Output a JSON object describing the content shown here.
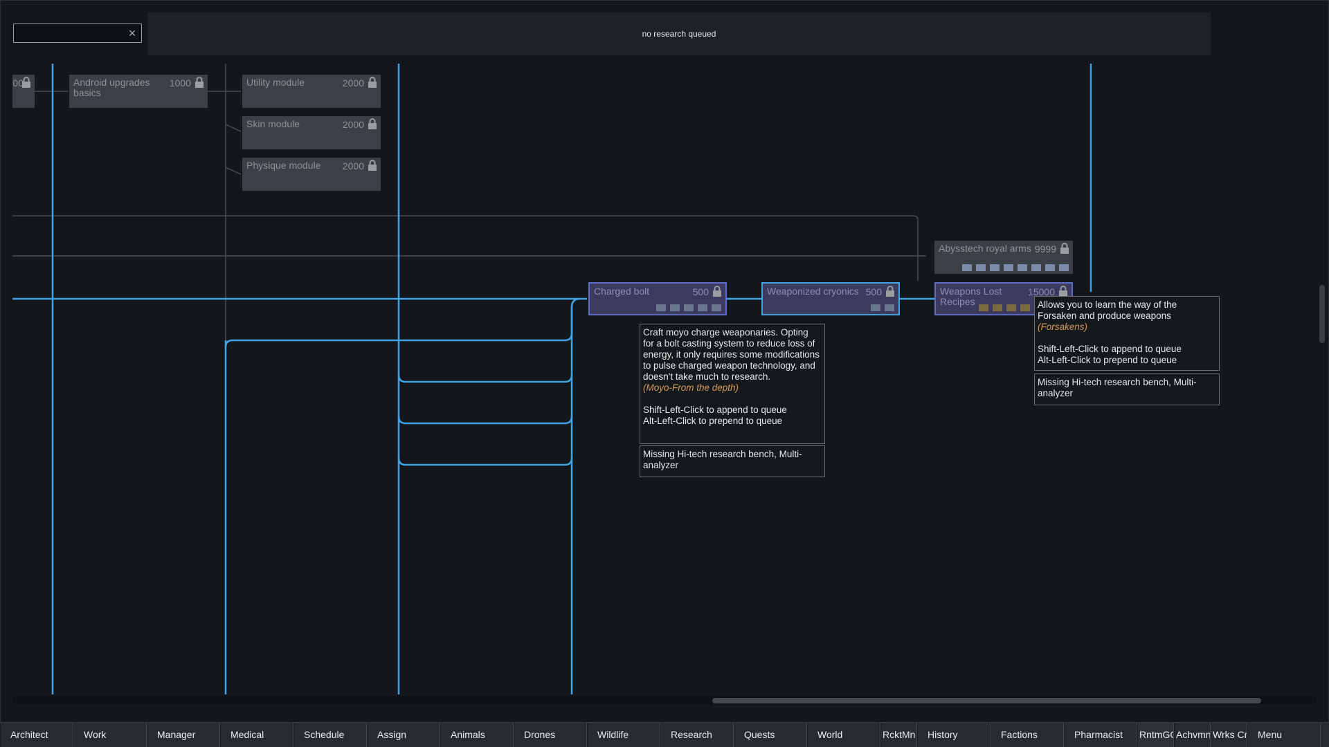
{
  "search": {
    "value": "",
    "clear_icon": "close-icon"
  },
  "queue": {
    "status": "no research queued"
  },
  "nodes": {
    "partial_left": {
      "cost": "00"
    },
    "android_upgrades": {
      "label": "Android upgrades basics",
      "cost": "1000"
    },
    "utility_module": {
      "label": "Utility module",
      "cost": "2000"
    },
    "skin_module": {
      "label": "Skin module",
      "cost": "2000"
    },
    "physique_module": {
      "label": "Physique module",
      "cost": "2000"
    },
    "abysstech_royal": {
      "label": "Abysstech royal arms",
      "cost": "9999"
    },
    "charged_bolt": {
      "label": "Charged bolt",
      "cost": "500"
    },
    "weaponized_cryonics": {
      "label": "Weaponized cryonics",
      "cost": "500"
    },
    "weapons_lost": {
      "label": "Weapons Lost Recipes",
      "cost": "15000"
    }
  },
  "tooltips": {
    "charged_bolt": {
      "description": "Craft moyo charge weaponaries. Opting for a bolt casting system to reduce loss of energy, it only requires some modifications to pulse charged weapon technology, and doesn't take much to research.",
      "mod": "(Moyo-From the depth)",
      "append_hint": "Shift-Left-Click to append to queue",
      "prepend_hint": "Alt-Left-Click to prepend to queue",
      "missing": "Missing Hi-tech research bench, Multi-analyzer"
    },
    "weapons_lost": {
      "description": "Allows you to learn the way of the Forsaken and produce weapons",
      "mod": "(Forsakens)",
      "append_hint": "Shift-Left-Click to append to queue",
      "prepend_hint": "Alt-Left-Click to prepend to queue",
      "missing": "Missing Hi-tech research bench, Multi-analyzer"
    }
  },
  "tabs": [
    "Architect",
    "Work",
    "Manager",
    "Medical",
    "Schedule",
    "Assign",
    "Animals",
    "Drones",
    "Wildlife",
    "Research",
    "Quests",
    "World",
    "RcktMn",
    "History",
    "Factions",
    "Pharmacist",
    "RntmGC",
    "Achvmn",
    "Wrks Cr",
    "Menu"
  ],
  "colors": {
    "prereq_line": "#3fa3e6",
    "inactive_line": "#4a4f54",
    "mod_text": "#d49a5c"
  }
}
